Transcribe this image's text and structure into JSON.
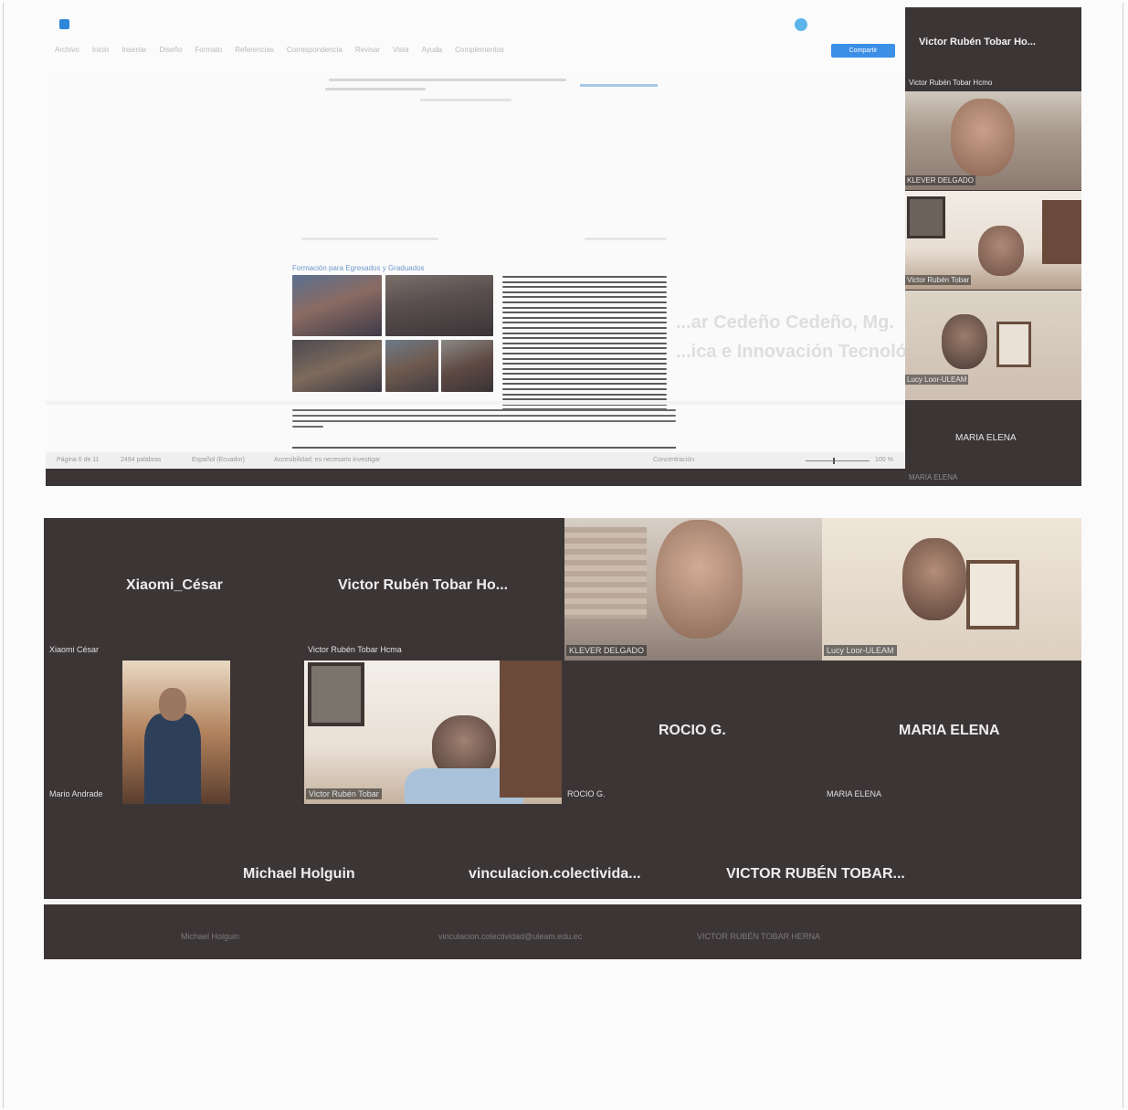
{
  "top_screenshot": {
    "doc_menu_tabs": [
      "Archivo",
      "Inicio",
      "Insertar",
      "Diseño",
      "Formato",
      "Referencias",
      "Correspondencia",
      "Revisar",
      "Vista",
      "Ayuda",
      "Complementos"
    ],
    "share_button_label": "Compartir",
    "doc_heading": "Formación para Egresados y Graduados",
    "status_items": [
      "Página 6 de 11",
      "2494 palabras",
      "Español (Ecuador)",
      "Accesibilidad: es necesario investigar",
      "Concentración",
      "100 %"
    ],
    "side_panel": {
      "top_name": "Victor Rubén Tobar Ho...",
      "participants": [
        {
          "name": "Victor Rubén Tobar Hcmo"
        },
        {
          "name": "KLEVER DELGADO"
        },
        {
          "name": "Victor Rubén Tobar"
        },
        {
          "name": "Lucy Loor-ULEAM"
        }
      ],
      "bottom_name": "MARIA ELENA",
      "bottom_name_small": "MARIA ELENA"
    },
    "watermark_lines": [
      "...ar Cedeño Cedeño, Mg.",
      "...ica e Innovación Tecnológica"
    ]
  },
  "gallery": {
    "tiles": [
      {
        "name": "Xiaomi_César",
        "label": "Xiaomi César"
      },
      {
        "name": "Victor Rubén Tobar Ho...",
        "label": "Victor Rubén Tobar Hcma"
      },
      {
        "name": "",
        "label": "KLEVER DELGADO"
      },
      {
        "name": "",
        "label": "Lucy Loor-ULEAM"
      },
      {
        "name": "",
        "label": "Mario Andrade"
      },
      {
        "name": "",
        "label": "Victor Rubén Tobar"
      },
      {
        "name": "ROCIO G.",
        "label": "ROCIO G."
      },
      {
        "name": "MARIA ELENA",
        "label": "MARIA ELENA"
      },
      {
        "name": "Michael Holguin",
        "label": "Michael Holguin"
      },
      {
        "name": "vinculacion.colectivida...",
        "label": "vinculacion.colectividad@uleam.edu.ec"
      },
      {
        "name": "VICTOR RUBÉN TOBAR...",
        "label": "VICTOR RUBÉN TOBAR HERNA"
      }
    ]
  }
}
